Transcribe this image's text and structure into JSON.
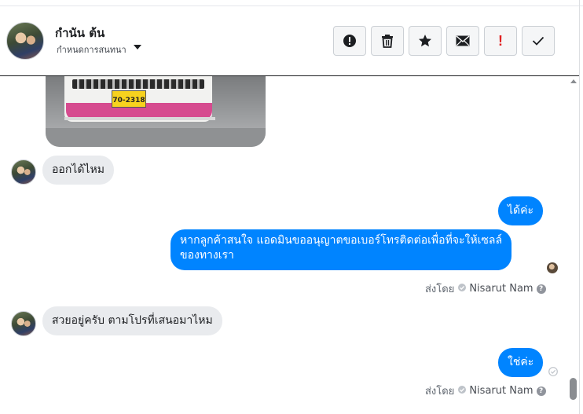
{
  "header": {
    "name": "กำนัน ต้น",
    "subtitle": "กำหนดการสนทนา",
    "actions": [
      "spam-icon",
      "trash-icon",
      "star-icon",
      "envelope-icon",
      "important-icon",
      "checkmark-icon"
    ]
  },
  "attachment": {
    "plate_text": "70-2318"
  },
  "messages": [
    {
      "direction": "in",
      "text": "ออกได้ไหม"
    },
    {
      "direction": "out",
      "text": "ได้ค่ะ"
    },
    {
      "direction": "out",
      "lines": [
        "หากลูกค้าสนใจ แอดมินขออนุญาตขอเบอร์โทรติดต่อเพื่อที่จะให้เซลล์",
        "ของทางเรา"
      ]
    },
    {
      "direction": "in",
      "text": "สวยอยู่ครับ ตามโปรที่เสนอมาไหม"
    },
    {
      "direction": "out",
      "text": "ใช่ค่ะ"
    }
  ],
  "sent_by": [
    {
      "prefix": "ส่งโดย",
      "agent": "Nisarut Nam",
      "help": "?"
    },
    {
      "prefix": "ส่งโดย",
      "agent": "Nisarut Nam",
      "help": "?"
    }
  ],
  "colors": {
    "outgoing_bubble": "#0084ff",
    "incoming_bubble": "#e9ebee",
    "important_icon": "#e02020"
  }
}
